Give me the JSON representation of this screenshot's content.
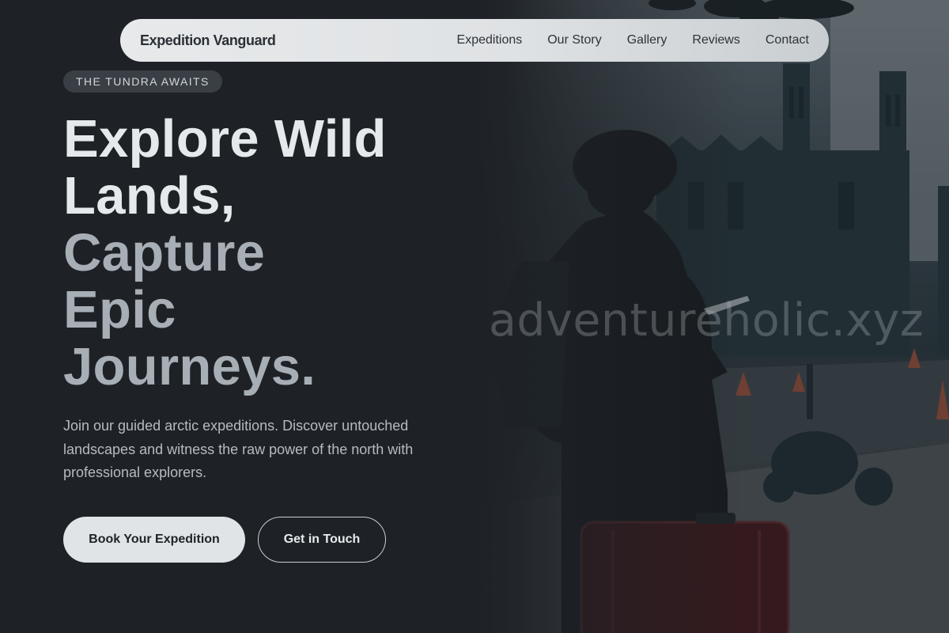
{
  "nav": {
    "brand": "Expedition Vanguard",
    "links": [
      "Expeditions",
      "Our Story",
      "Gallery",
      "Reviews",
      "Contact"
    ]
  },
  "hero": {
    "badge": "THE TUNDRA AWAITS",
    "headline": {
      "line1": "Explore Wild",
      "line2": "Lands,",
      "line3": "Capture",
      "line4": "Epic",
      "line5": "Journeys."
    },
    "description": "Join our guided arctic expeditions. Discover untouched landscapes and witness the raw power of the north with professional explorers.",
    "primary_button": "Book Your Expedition",
    "secondary_button": "Get in Touch"
  },
  "photo": {
    "watermark": "adventureholic.xyz",
    "subject": "traveler-with-suitcase"
  },
  "colors": {
    "background": "#1e2226",
    "headline_light": "#e6e9ec",
    "headline_muted": "#a8aeb5",
    "nav_background": "#e1e4e7",
    "suitcase": "#4a1a1e"
  }
}
